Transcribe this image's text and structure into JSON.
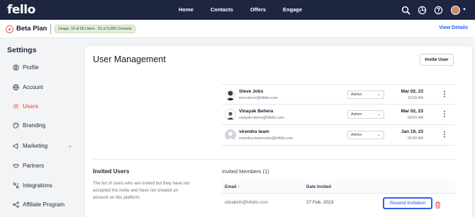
{
  "nav": {
    "logo": "fello",
    "links": [
      "Home",
      "Contacts",
      "Offers",
      "Engage"
    ],
    "icons": [
      "search-icon",
      "pie-icon",
      "help-icon",
      "avatar",
      "chevron-down-icon"
    ]
  },
  "plan": {
    "title": "Beta Plan",
    "usage": "Usage: 16 of 50 Users · 51 of 5,000 Contacts",
    "view_details": "View Details"
  },
  "sidebar": {
    "title": "Settings",
    "items": [
      {
        "label": "Profile",
        "icon": "user-circle-icon"
      },
      {
        "label": "Account",
        "icon": "globe-icon"
      },
      {
        "label": "Users",
        "icon": "users-icon"
      },
      {
        "label": "Branding",
        "icon": "palette-icon"
      },
      {
        "label": "Marketing",
        "icon": "megaphone-icon"
      },
      {
        "label": "Partners",
        "icon": "handshake-icon"
      },
      {
        "label": "Integrations",
        "icon": "plug-icon"
      },
      {
        "label": "Affiliate Program",
        "icon": "share-icon"
      }
    ],
    "active": "Users"
  },
  "main": {
    "title": "User Management",
    "invite_button": "Invite User",
    "users": [
      {
        "name": "Steve Jobs",
        "email": "tom+demo@hifello.com",
        "role": "Admin",
        "date": "Mar 02, 23",
        "time": "10:59 AM"
      },
      {
        "name": "Vinayak Behera",
        "email": "vinayak+demo@hifello.com",
        "role": "Admin",
        "date": "Mar 02, 23",
        "time": "09:04 AM"
      },
      {
        "name": "virendra team",
        "email": "virendra+team+plan@hifello.com",
        "role": "Admin",
        "date": "Jan 19, 23",
        "time": "06:00 AM"
      }
    ],
    "invited": {
      "title": "Invited Users",
      "description": "The list of users who are invited but they have not accepted the invite and have not created an account on this platform",
      "members_label": "Invited Members (1)",
      "columns": [
        "Email ↑",
        "Date Invited"
      ],
      "rows": [
        {
          "email": "elizabeth@hifello.com",
          "date": "27 Feb, 2023",
          "action": "Resend Invitation"
        }
      ]
    }
  },
  "colors": {
    "nav_bg": "#1e2540",
    "accent": "#ef6b52",
    "link": "#2563eb",
    "usage_badge_bg": "#e0efd6"
  }
}
